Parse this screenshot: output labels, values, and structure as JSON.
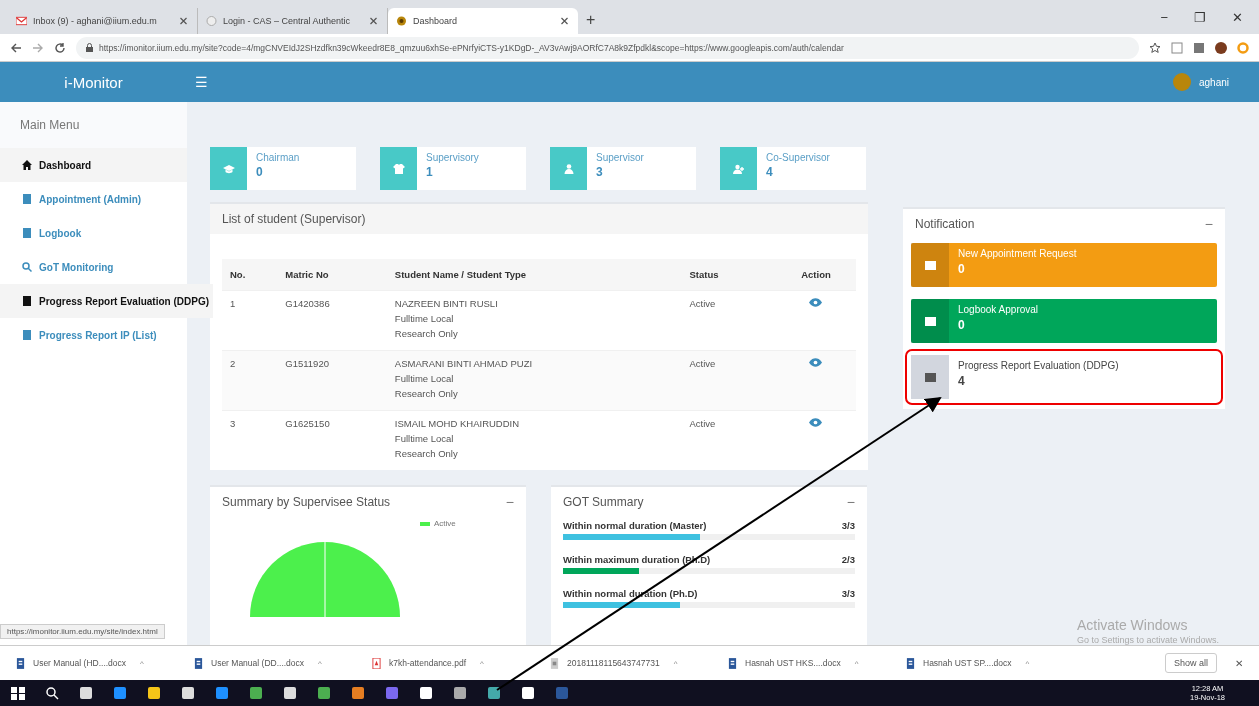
{
  "browser": {
    "tabs": [
      {
        "title": "Inbox (9) - aghani@iium.edu.m",
        "kind": "mail",
        "selected": false
      },
      {
        "title": "Login - CAS – Central Authentic",
        "kind": "page",
        "selected": false
      },
      {
        "title": "Dashboard",
        "kind": "site",
        "selected": true
      }
    ],
    "new_tab": "+",
    "window_controls": [
      "−",
      "❐",
      "✕"
    ],
    "url": "https://imonitor.iium.edu.my/site?code=4/mgCNVEIdJ2SHzdfkn39cWkeedr8E8_qmzuu6xhSe-ePNrfyiCTS-y1KDgD-_AV3vAwj9AORfC7A8k9Zfpdkl&scope=https://www.googleapis.com/auth/calendar"
  },
  "app": {
    "brand": "i-Monitor",
    "menu_toggle": "☰",
    "user": "aghani"
  },
  "sidebar": {
    "title": "Main Menu",
    "items": [
      {
        "label": "Dashboard",
        "kind": "home",
        "selected": true
      },
      {
        "label": "Appointment (Admin)",
        "kind": "book",
        "selected": false
      },
      {
        "label": "Logbook",
        "kind": "book",
        "selected": false
      },
      {
        "label": "GoT Monitoring",
        "kind": "search",
        "selected": false
      },
      {
        "label": "Progress Report Evaluation (DDPG)",
        "kind": "book",
        "selected": true
      },
      {
        "label": "Progress Report IP (List)",
        "kind": "book",
        "selected": false
      }
    ]
  },
  "stats": [
    {
      "label": "Chairman",
      "value": "0",
      "kind": "cap"
    },
    {
      "label": "Supervisory",
      "value": "1",
      "kind": "shirt"
    },
    {
      "label": "Supervisor",
      "value": "3",
      "kind": "user"
    },
    {
      "label": "Co-Supervisor",
      "value": "4",
      "kind": "users"
    }
  ],
  "students": {
    "title": "List of student (Supervisor)",
    "columns": [
      "No.",
      "Matric No",
      "Student Name / Student Type",
      "Status",
      "Action"
    ],
    "rows": [
      {
        "no": "1",
        "matric": "G1420386",
        "name": "NAZREEN BINTI RUSLI",
        "type": "Fulltime Local",
        "mode": "Research Only",
        "status": "Active"
      },
      {
        "no": "2",
        "matric": "G1511920",
        "name": "ASMARANI BINTI AHMAD PUZI",
        "type": "Fulltime Local",
        "mode": "Research Only",
        "status": "Active"
      },
      {
        "no": "3",
        "matric": "G1625150",
        "name": "ISMAIL MOHD KHAIRUDDIN",
        "type": "Fulltime Local",
        "mode": "Research Only",
        "status": "Active"
      }
    ]
  },
  "notification": {
    "title": "Notification",
    "collapse": "−",
    "items": [
      {
        "label": "New Appointment Request",
        "count": "0",
        "kind": "filled",
        "color": "#f39c12",
        "highlighted": false
      },
      {
        "label": "Logbook Approval",
        "count": "0",
        "kind": "filled",
        "color": "#00a65a",
        "highlighted": false
      },
      {
        "label": "Progress Report Evaluation (DDPG)",
        "count": "4",
        "kind": "plain",
        "color": "#d2d6de",
        "highlighted": true
      }
    ]
  },
  "supervisee_summary": {
    "title": "Summary by Supervisee Status",
    "collapse": "−",
    "legend": [
      {
        "label": "Active",
        "color": "#4cf04c"
      }
    ]
  },
  "got_summary": {
    "title": "GOT Summary",
    "collapse": "−",
    "rows": [
      {
        "label": "Within normal duration (Master)",
        "reading": "3/3",
        "level": 0.47,
        "color": "#3ec1e0"
      },
      {
        "label": "Within maximum duration (Ph.D)",
        "reading": "2/3",
        "level": 0.26,
        "color": "#00a65a"
      },
      {
        "label": "Within normal duration (Ph.D)",
        "reading": "3/3",
        "level": 0.4,
        "color": "#3ec1e0"
      }
    ]
  },
  "status_url": "https://imonitor.iium.edu.my/site/index.html",
  "activate_windows": {
    "title": "Activate Windows",
    "subtitle": "Go to Settings to activate Windows."
  },
  "downloads": {
    "items": [
      {
        "name": "User Manual (HD....docx",
        "kind": "doc"
      },
      {
        "name": "User Manual (DD....docx",
        "kind": "doc"
      },
      {
        "name": "k7kh-attendance.pdf",
        "kind": "pdf"
      },
      {
        "name": "20181118115643747731",
        "kind": "file"
      },
      {
        "name": "Hasnah UST HKS....docx",
        "kind": "doc"
      },
      {
        "name": "Hasnah UST SP....docx",
        "kind": "doc"
      }
    ],
    "caret": "^",
    "show_all": "Show all",
    "close": "✕"
  },
  "taskbar": {
    "time": "12:28 AM",
    "date": "19-Nov-18"
  }
}
